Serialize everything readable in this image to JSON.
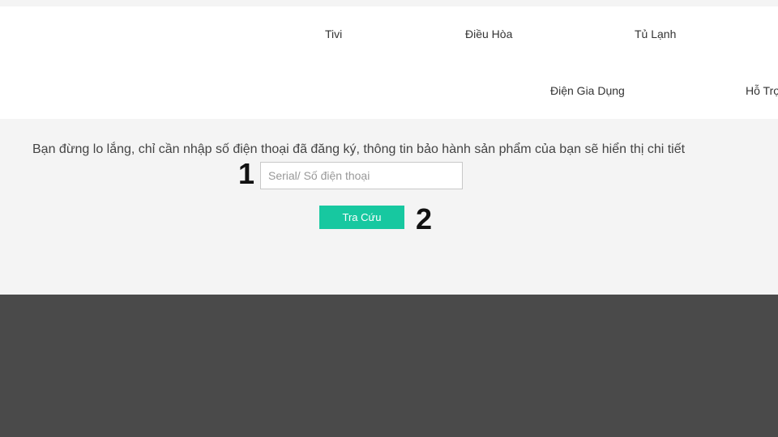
{
  "nav": {
    "items": [
      {
        "label": "Tivi"
      },
      {
        "label": "Điều Hòa"
      },
      {
        "label": "Tủ Lạnh"
      },
      {
        "label": "Điện Gia Dụng"
      },
      {
        "label": "Hỗ Trợ"
      }
    ]
  },
  "lookup": {
    "instruction": "Bạn đừng lo lắng, chỉ cần nhập số điện thoại đã đăng ký, thông tin bảo hành sản phẩm của bạn sẽ hiển thị chi tiết",
    "step_1": "1",
    "step_2": "2",
    "input_value": "",
    "input_placeholder": "Serial/ Số điện thoại",
    "button_label": "Tra Cứu"
  },
  "colors": {
    "button_bg": "#17c8a0",
    "section_bg": "#f4f4f4",
    "footer_bg": "#4a4a4a",
    "header_bg": "#ffffff"
  }
}
